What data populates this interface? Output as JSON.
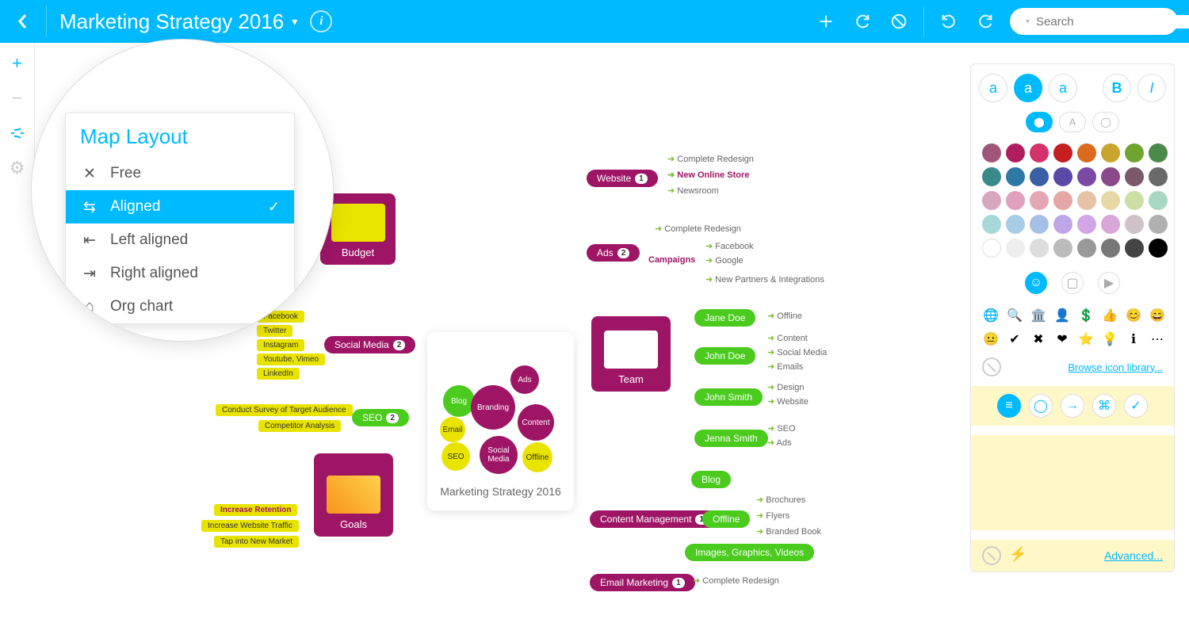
{
  "header": {
    "title": "Marketing Strategy 2016",
    "search_placeholder": "Search"
  },
  "layout_popup": {
    "title": "Map Layout",
    "items": [
      {
        "label": "Free",
        "selected": false
      },
      {
        "label": "Aligned",
        "selected": true
      },
      {
        "label": "Left aligned",
        "selected": false
      },
      {
        "label": "Right aligned",
        "selected": false
      },
      {
        "label": "Org chart",
        "selected": false
      }
    ]
  },
  "mindmap": {
    "central": {
      "title": "Marketing Strategy 2016",
      "bubbles": [
        "Blog",
        "Ads",
        "Branding",
        "Email",
        "SEO",
        "Content",
        "Social Media",
        "Offline"
      ]
    },
    "left_cards": [
      {
        "label": "Budget"
      },
      {
        "label": "Social Media",
        "children": [
          "Facebook",
          "Twitter",
          "Instagram",
          "Youtube, Vimeo",
          "LinkedIn"
        ]
      },
      {
        "label": "SEO",
        "children": [
          "Conduct Survey of Target Audience",
          "Competitor Analysis"
        ]
      },
      {
        "label": "Goals",
        "children": [
          "Increase Retention",
          "Increase Website Traffic",
          "Tap into New Market"
        ]
      }
    ],
    "right_nodes": {
      "website": {
        "label": "Website",
        "children": [
          "Complete Redesign",
          "New Online Store",
          "Newsroom"
        ]
      },
      "ads": {
        "label": "Ads",
        "campaigns_label": "Campaigns",
        "children": [
          "Complete Redesign",
          "Facebook",
          "Google",
          "New Partners & Integrations"
        ]
      },
      "team": {
        "label": "Team",
        "members": [
          {
            "name": "Jane Doe",
            "items": [
              "Offline"
            ]
          },
          {
            "name": "John Doe",
            "items": [
              "Content",
              "Social Media",
              "Emails"
            ]
          },
          {
            "name": "John Smith",
            "items": [
              "Design",
              "Website"
            ]
          },
          {
            "name": "Jenna Smith",
            "items": [
              "SEO",
              "Ads"
            ]
          }
        ]
      },
      "content_mgmt": {
        "label": "Content Management",
        "blog": "Blog",
        "offline_label": "Offline",
        "offline_items": [
          "Brochures",
          "Flyers",
          "Branded Book"
        ],
        "extra": "Images, Graphics, Videos"
      },
      "email": {
        "label": "Email Marketing",
        "children": [
          "Complete Redesign"
        ]
      }
    }
  },
  "right_panel": {
    "font_buttons": [
      "a",
      "a",
      "a",
      "B",
      "I"
    ],
    "colors": [
      "#a0567a",
      "#b01e5f",
      "#d4326a",
      "#c41e1e",
      "#d96a1e",
      "#c7a52e",
      "#6fa52e",
      "#4a8a4a",
      "#3a8a8a",
      "#2e7aa5",
      "#3a5fa5",
      "#5a4aa5",
      "#7a4aa5",
      "#8a4a8a",
      "#7a5a6a",
      "#6a6a6a",
      "#d9a6c2",
      "#e0a0bf",
      "#e4a6b5",
      "#e4a6a6",
      "#e6c2a6",
      "#e6d9a6",
      "#cce0a6",
      "#a6d9bf",
      "#a6d9d9",
      "#a6cce6",
      "#a6bfe6",
      "#bfa6e6",
      "#d0a6e6",
      "#d9a6d9",
      "#cfc2c9",
      "#b0b0b0",
      "#ffffff",
      "#eeeeee",
      "#dddddd",
      "#bbbbbb",
      "#999999",
      "#777777",
      "#444444",
      "#000000"
    ],
    "icons": [
      "🌐",
      "🔍",
      "🏛️",
      "👤",
      "💲",
      "👍",
      "😊",
      "😄",
      "😐",
      "✔",
      "✖",
      "❤",
      "⭐",
      "💡",
      "ℹ",
      "⋯"
    ],
    "browse_link": "Browse icon library...",
    "advanced_link": "Advanced..."
  }
}
